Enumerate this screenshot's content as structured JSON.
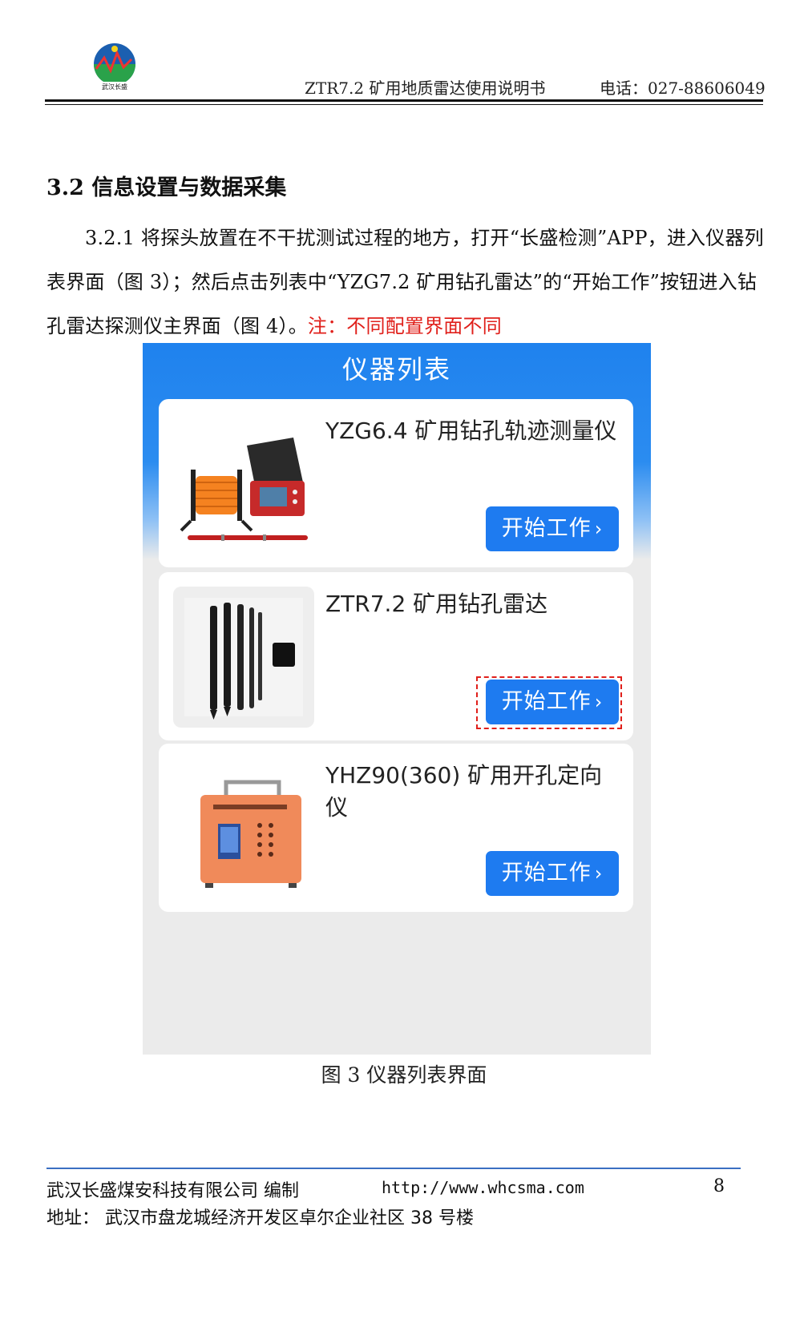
{
  "header": {
    "logo_text": "武汉长盛",
    "doc_title": "ZTR7.2 矿用地质雷达使用说明书",
    "phone": "电话：027-88606049"
  },
  "section": {
    "heading": "3.2 信息设置与数据采集",
    "paragraph_main": "3.2.1 将探头放置在不干扰测试过程的地方，打开“长盛检测”APP，进入仪器列表界面（图 3）；然后点击列表中“YZG7.2 矿用钻孔雷达”的“开始工作”按钮进入钻孔雷达探测仪主界面（图 4）。",
    "note": "注：不同配置界面不同"
  },
  "screenshot": {
    "title": "仪器列表",
    "devices": [
      {
        "name": "YZG6.4 矿用钻孔轨迹测量仪",
        "button": "开始工作"
      },
      {
        "name": "ZTR7.2 矿用钻孔雷达",
        "button": "开始工作"
      },
      {
        "name": "YHZ90(360) 矿用开孔定向仪",
        "button": "开始工作"
      }
    ]
  },
  "caption": "图 3  仪器列表界面",
  "footer": {
    "company": "武汉长盛煤安科技有限公司 编制",
    "url": "http://www.whcsma.com",
    "page": "8",
    "address": "地址：  武汉市盘龙城经济开发区卓尔企业社区 38 号楼"
  },
  "colors": {
    "accent_blue": "#1e7bf0",
    "note_red": "#e0201b"
  }
}
